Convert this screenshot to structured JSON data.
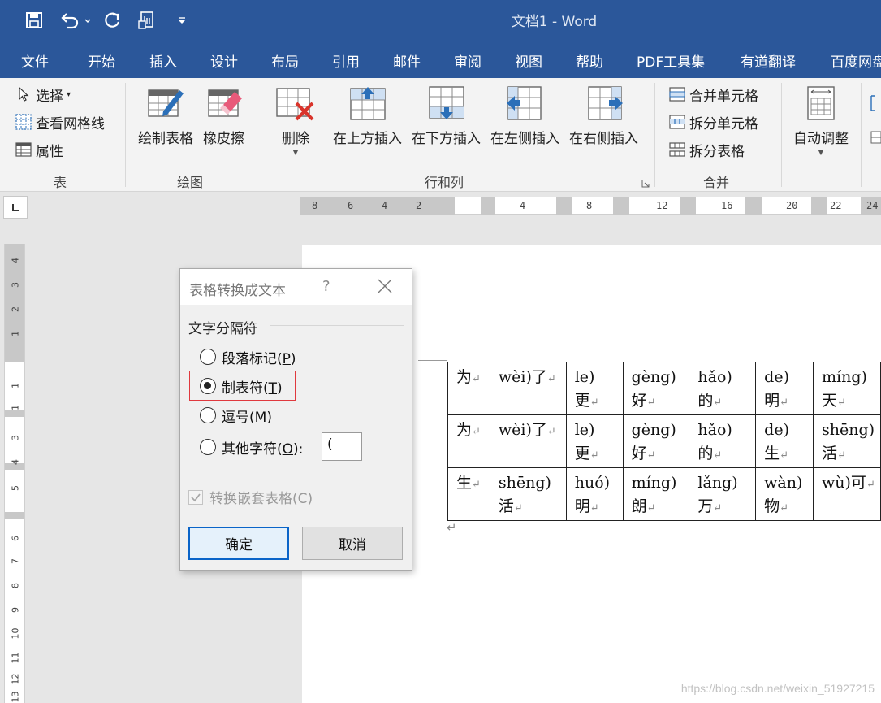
{
  "window": {
    "title": "文档1  -  Word"
  },
  "quick_access": {
    "icons": [
      "save-icon",
      "undo-icon",
      "redo-icon",
      "touch-mode-icon",
      "customize-icon"
    ]
  },
  "menu": {
    "tabs": [
      "文件",
      "开始",
      "插入",
      "设计",
      "布局",
      "引用",
      "邮件",
      "审阅",
      "视图",
      "帮助",
      "PDF工具集",
      "有道翻译",
      "百度网盘"
    ]
  },
  "ribbon": {
    "table_group": {
      "label": "表",
      "items": [
        "选择",
        "查看网格线",
        "属性"
      ]
    },
    "draw_group": {
      "label": "绘图",
      "items": [
        "绘制表格",
        "橡皮擦"
      ]
    },
    "rows_cols_group": {
      "label": "行和列",
      "items": [
        "删除",
        "在上方插入",
        "在下方插入",
        "在左侧插入",
        "在右侧插入"
      ]
    },
    "merge_group": {
      "label": "合并",
      "items": [
        "合并单元格",
        "拆分单元格",
        "拆分表格"
      ]
    },
    "autofit": {
      "label": "自动调整"
    }
  },
  "ruler": {
    "horizontal_labels": [
      "8",
      "6",
      "4",
      "2",
      "4",
      "8",
      "12",
      "16",
      "20",
      "22",
      "24"
    ],
    "vertical_labels": [
      "4",
      "3",
      "2",
      "1",
      "1",
      "1",
      "3",
      "4",
      "5",
      "6",
      "7",
      "8",
      "9",
      "10",
      "11",
      "12",
      "13"
    ]
  },
  "document": {
    "paragraph_mark": "↵",
    "table_rows": [
      [
        [
          "为"
        ],
        [
          "wèi)了"
        ],
        [
          "le)",
          "更"
        ],
        [
          "gèng)",
          "好"
        ],
        [
          "hǎo)",
          "的"
        ],
        [
          "de)",
          "明"
        ],
        [
          "míng)",
          "天"
        ]
      ],
      [
        [
          "为"
        ],
        [
          "wèi)了"
        ],
        [
          "le)",
          "更"
        ],
        [
          "gèng)",
          "好"
        ],
        [
          "hǎo)",
          "的"
        ],
        [
          "de)",
          "生"
        ],
        [
          "shēng)",
          "活"
        ]
      ],
      [
        [
          "生"
        ],
        [
          "shēng)",
          "活"
        ],
        [
          "huó)",
          "明"
        ],
        [
          "míng)",
          "朗"
        ],
        [
          "lǎng)",
          "万"
        ],
        [
          "wàn)",
          "物"
        ],
        [
          "wù)可"
        ]
      ]
    ]
  },
  "dialog": {
    "title": "表格转换成文本",
    "help": "?",
    "section_label": "文字分隔符",
    "options": [
      {
        "label": "段落标记(",
        "key": "P",
        "suffix": ")",
        "selected": false
      },
      {
        "label": "制表符(",
        "key": "T",
        "suffix": ")",
        "selected": true
      },
      {
        "label": "逗号(",
        "key": "M",
        "suffix": ")",
        "selected": false
      },
      {
        "label": "其他字符(",
        "key": "O",
        "suffix": "):",
        "selected": false
      }
    ],
    "other_char_value": "(",
    "nested_tables_label": "转换嵌套表格(C)",
    "nested_tables_checked": true,
    "ok_label": "确定",
    "cancel_label": "取消",
    "highlight_color": "#e0393e"
  },
  "watermark": "https://blog.csdn.net/weixin_51927215",
  "colors": {
    "accent": "#2b579a"
  }
}
